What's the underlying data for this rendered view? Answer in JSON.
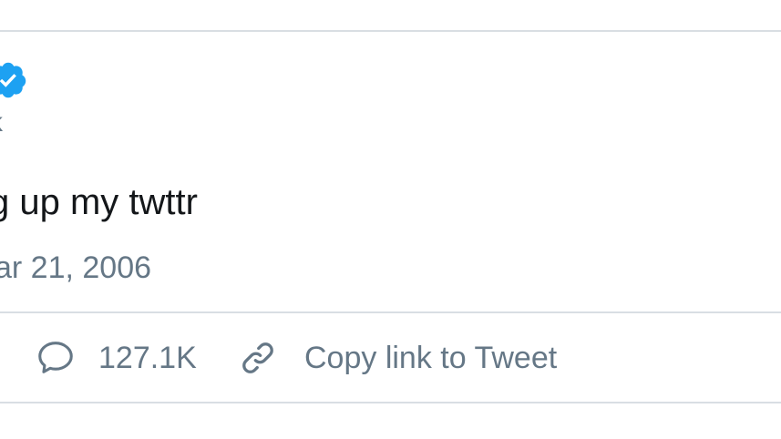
{
  "tweet": {
    "handle_fragment": "k",
    "text_fragment": "g up my twttr",
    "timestamp_fragment": "ar 21, 2006"
  },
  "actions": {
    "reply_count": "127.1K",
    "copy_link_label": "Copy link to Tweet"
  },
  "icons": {
    "verified": "verified-badge-icon",
    "reply": "speech-bubble-icon",
    "copy_link": "link-icon"
  },
  "colors": {
    "verified_blue": "#1da1f2",
    "text_primary": "#14171a",
    "text_secondary": "#657786",
    "divider": "#d9dee3"
  }
}
